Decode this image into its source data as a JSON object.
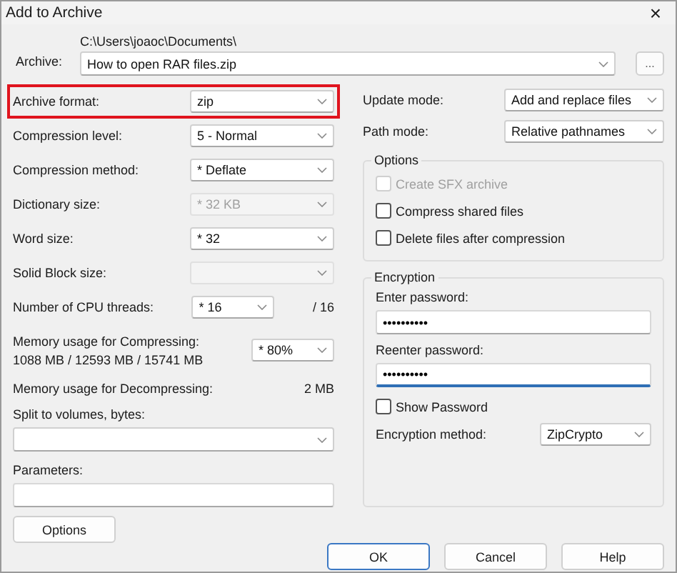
{
  "window": {
    "title": "Add to Archive",
    "close": "×"
  },
  "archive": {
    "label": "Archive:",
    "path": "C:\\Users\\joaoc\\Documents\\",
    "filename": "How to open RAR files.zip",
    "browse": "..."
  },
  "left_rows": [
    {
      "kind": "combo",
      "label": "Archive format:",
      "value": "zip",
      "disabled": false,
      "highlighted": true
    },
    {
      "kind": "combo",
      "label": "Compression level:",
      "value": "5 - Normal",
      "disabled": false,
      "highlighted": false
    },
    {
      "kind": "combo",
      "label": "Compression method:",
      "value": "* Deflate",
      "disabled": false,
      "highlighted": false
    },
    {
      "kind": "combo",
      "label": "Dictionary size:",
      "value": "* 32 KB",
      "disabled": true,
      "highlighted": false
    },
    {
      "kind": "combo",
      "label": "Word size:",
      "value": "* 32",
      "disabled": false,
      "highlighted": false
    },
    {
      "kind": "combo",
      "label": "Solid Block size:",
      "value": "",
      "disabled": true,
      "highlighted": false
    },
    {
      "kind": "threads",
      "label": "Number of CPU threads:",
      "value": "* 16",
      "suffix": "/ 16"
    },
    {
      "kind": "memory",
      "label": "Memory usage for Compressing:",
      "detail": "1088 MB / 12593 MB / 15741 MB",
      "value": "* 80%"
    },
    {
      "kind": "static",
      "label": "Memory usage for Decompressing:",
      "value": "2 MB"
    },
    {
      "kind": "wide_combo",
      "label": "Split to volumes, bytes:",
      "value": ""
    },
    {
      "kind": "field",
      "label": "Parameters:",
      "value": ""
    }
  ],
  "options_button": "Options",
  "right_rows": [
    {
      "label": "Update mode:",
      "value": "Add and replace files"
    },
    {
      "label": "Path mode:",
      "value": "Relative pathnames"
    }
  ],
  "options_group": {
    "title": "Options",
    "checkboxes": [
      {
        "label": "Create SFX archive",
        "checked": false,
        "disabled": true
      },
      {
        "label": "Compress shared files",
        "checked": false,
        "disabled": false
      },
      {
        "label": "Delete files after compression",
        "checked": false,
        "disabled": false
      }
    ]
  },
  "encryption": {
    "title": "Encryption",
    "enter_label": "Enter password:",
    "enter_value": "••••••••••",
    "reenter_label": "Reenter password:",
    "reenter_value": "••••••••••",
    "reenter_focused": true,
    "show_password": {
      "label": "Show Password",
      "checked": false
    },
    "method_label": "Encryption method:",
    "method_value": "ZipCrypto"
  },
  "buttons": [
    {
      "label": "OK",
      "default": true
    },
    {
      "label": "Cancel",
      "default": false
    },
    {
      "label": "Help",
      "default": false
    }
  ]
}
